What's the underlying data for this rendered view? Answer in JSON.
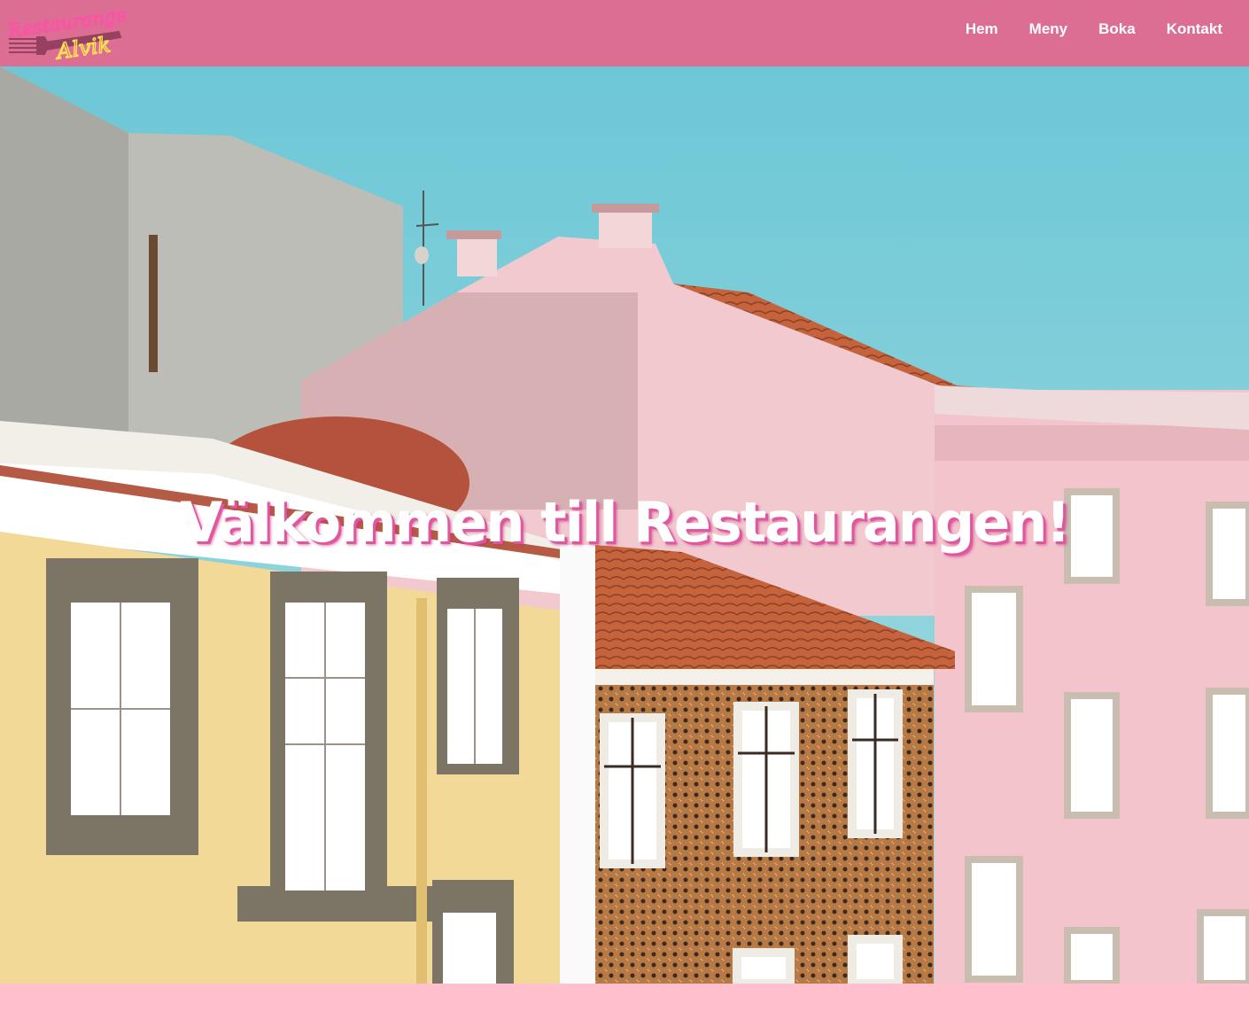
{
  "brand": {
    "logo_line1": "Restaurangen",
    "logo_line2": "Alvik",
    "colors": {
      "nav_bg": "#dc6e94",
      "logo_pink": "#ff4fa8",
      "logo_yellow": "#ffe84a",
      "footer_bg": "#ffbfcc"
    }
  },
  "nav": {
    "items": [
      {
        "label": "Hem"
      },
      {
        "label": "Meny"
      },
      {
        "label": "Boka"
      },
      {
        "label": "Kontakt"
      }
    ]
  },
  "hero": {
    "title": "Välkommen till Restaurangen!",
    "image_icon": "colorful-buildings-photo"
  }
}
